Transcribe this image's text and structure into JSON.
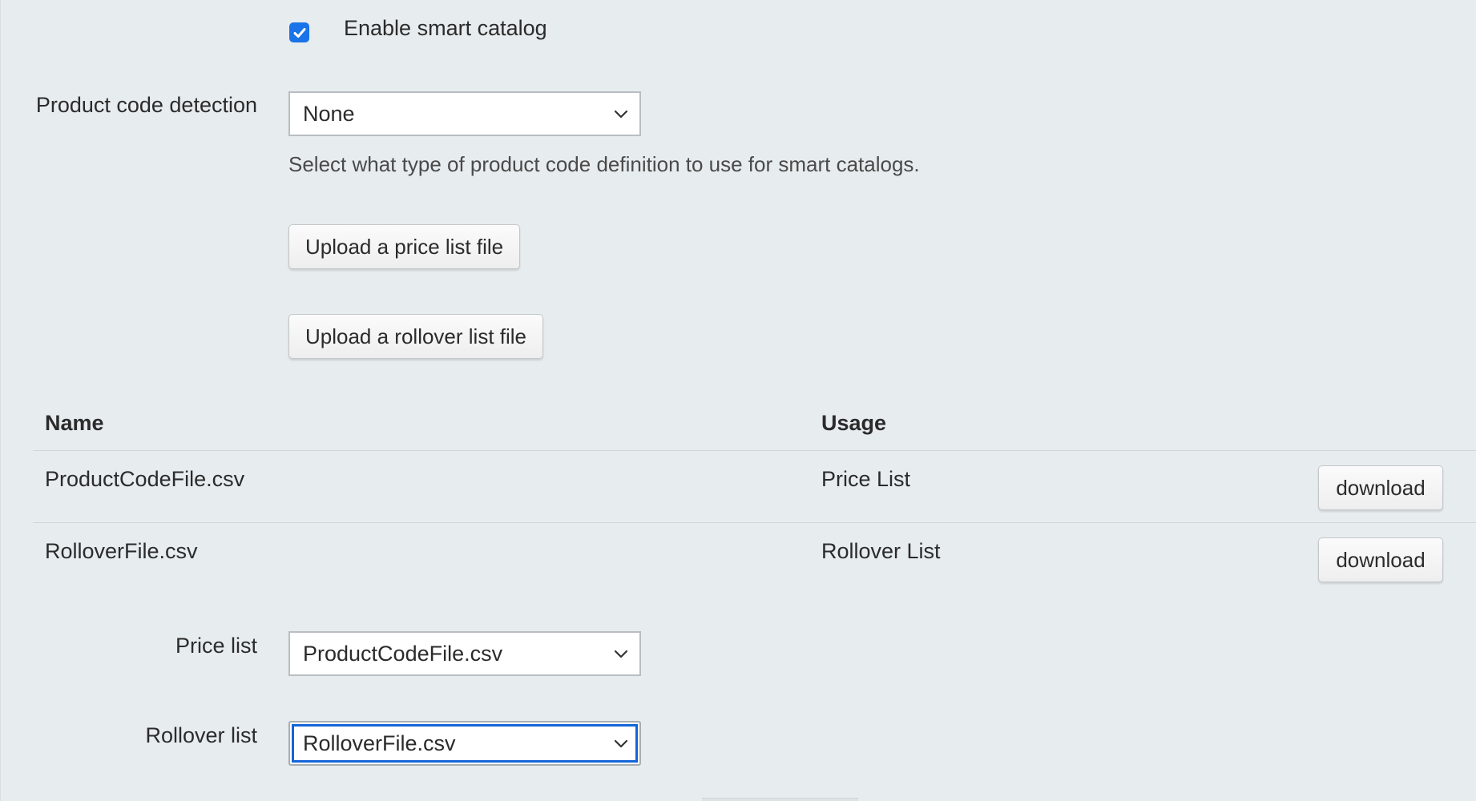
{
  "smart_catalog": {
    "enabled": true,
    "label": "Enable smart catalog"
  },
  "product_code_detection": {
    "label": "Product code detection",
    "selected": "None",
    "help": "Select what type of product code definition to use for smart catalogs."
  },
  "buttons": {
    "upload_price_list": "Upload a price list file",
    "upload_rollover_list": "Upload a rollover list file"
  },
  "files_table": {
    "columns": [
      "Name",
      "Usage"
    ],
    "rows": [
      {
        "name": "ProductCodeFile.csv",
        "usage": "Price List",
        "action": "download"
      },
      {
        "name": "RolloverFile.csv",
        "usage": "Rollover List",
        "action": "download"
      }
    ]
  },
  "price_list": {
    "label": "Price list",
    "selected": "ProductCodeFile.csv"
  },
  "rollover_list": {
    "label": "Rollover list",
    "selected": "RolloverFile.csv"
  },
  "colors": {
    "background": "#e7ecee",
    "checkbox_accent": "#1a73e8",
    "focus_ring": "#1565d8"
  },
  "icons": {
    "checkbox": "check-icon",
    "select": "chevron-down-icon"
  }
}
